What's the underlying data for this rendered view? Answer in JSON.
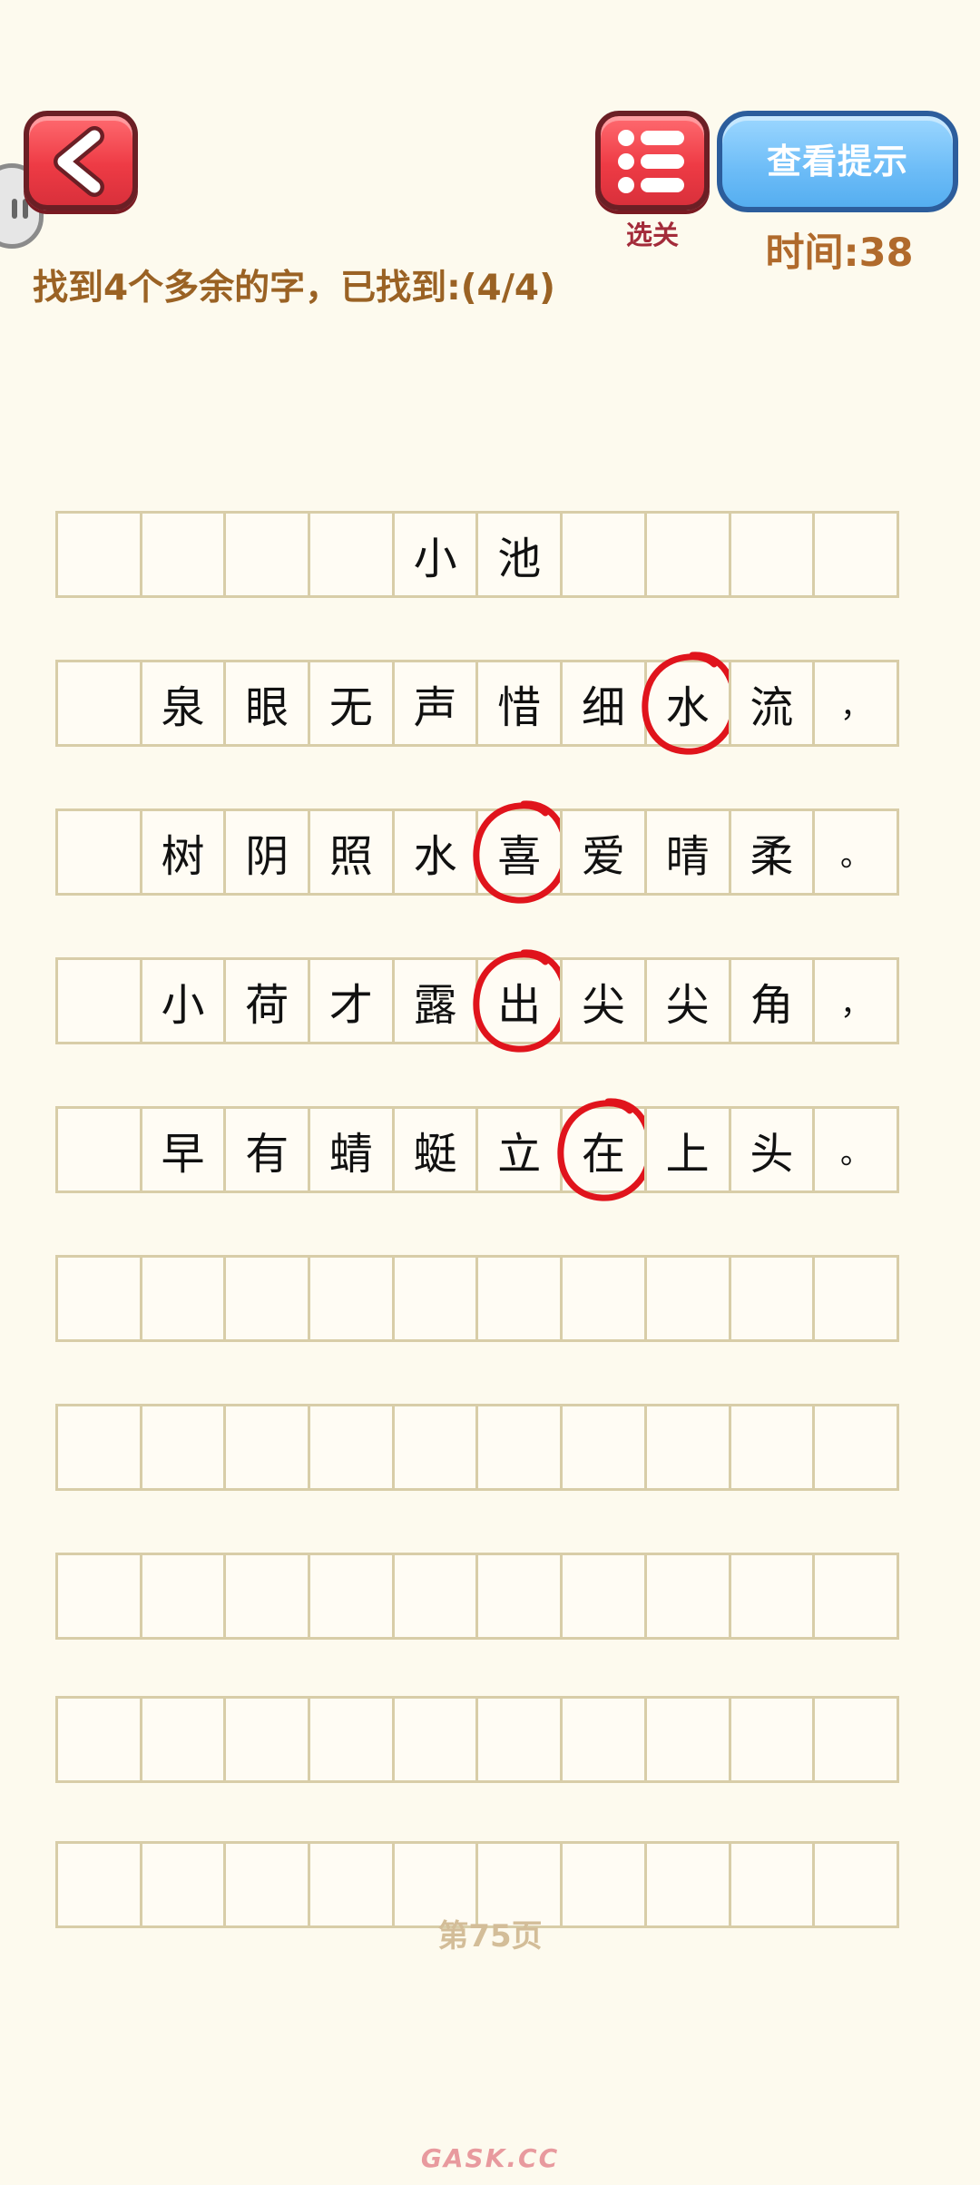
{
  "header": {
    "levels_label": "选关",
    "hint_label": "查看提示",
    "timer": "时间:38"
  },
  "progress_text": "找到4个多余的字，已找到:(4/4)",
  "grid": {
    "rows": [
      [
        "",
        "",
        "",
        "",
        "小",
        "池",
        "",
        "",
        "",
        ""
      ],
      [
        "",
        "泉",
        "眼",
        "无",
        "声",
        "惜",
        "细",
        "水",
        "流",
        "，"
      ],
      [
        "",
        "树",
        "阴",
        "照",
        "水",
        "喜",
        "爱",
        "晴",
        "柔",
        "。"
      ],
      [
        "",
        "小",
        "荷",
        "才",
        "露",
        "出",
        "尖",
        "尖",
        "角",
        "，"
      ],
      [
        "",
        "早",
        "有",
        "蜻",
        "蜓",
        "立",
        "在",
        "上",
        "头",
        "。"
      ],
      [
        "",
        "",
        "",
        "",
        "",
        "",
        "",
        "",
        "",
        ""
      ],
      [
        "",
        "",
        "",
        "",
        "",
        "",
        "",
        "",
        "",
        ""
      ],
      [
        "",
        "",
        "",
        "",
        "",
        "",
        "",
        "",
        "",
        ""
      ],
      [
        "",
        "",
        "",
        "",
        "",
        "",
        "",
        "",
        "",
        ""
      ],
      [
        "",
        "",
        "",
        "",
        "",
        "",
        "",
        "",
        "",
        ""
      ]
    ],
    "circled_characters": [
      "水",
      "喜",
      "出",
      "在"
    ],
    "accent_color": "#e0141c",
    "grid_line_color": "#d8cda8"
  },
  "page_label": "第75页",
  "watermark": "GASK.CC",
  "icons": {
    "back": "chevron-left-icon",
    "levels": "list-icon"
  }
}
